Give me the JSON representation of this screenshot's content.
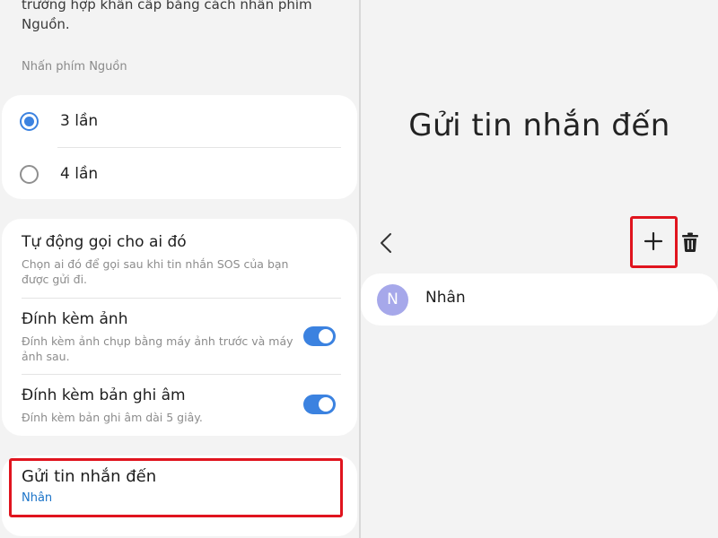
{
  "settings": {
    "intro_text": "trường hợp khẩn cấp bằng cách nhấn phím Nguồn.",
    "section_label": "Nhấn phím Nguồn",
    "press_options": [
      {
        "label": "3 lần",
        "selected": true
      },
      {
        "label": "4 lần",
        "selected": false
      }
    ],
    "auto_call": {
      "title": "Tự động gọi cho ai đó",
      "subtitle": "Chọn ai đó để gọi sau khi tin nhắn SOS của bạn được gửi đi."
    },
    "attach_photo": {
      "title": "Đính kèm ảnh",
      "subtitle": "Đính kèm ảnh chụp bằng máy ảnh trước và máy ảnh sau.",
      "enabled": true
    },
    "attach_audio": {
      "title": "Đính kèm bản ghi âm",
      "subtitle": "Đính kèm bản ghi âm dài 5 giây.",
      "enabled": true
    },
    "send_to": {
      "title": "Gửi tin nhắn đến",
      "value": "Nhân"
    }
  },
  "recipients": {
    "title": "Gửi tin nhắn đến",
    "contacts": [
      {
        "initial": "N",
        "name": "Nhân"
      }
    ]
  },
  "colors": {
    "accent": "#3b82e0",
    "highlight_box": "#e0141e",
    "avatar": "#a6a8ea",
    "link": "#1a73c8"
  },
  "icons": {
    "back": "chevron-left-icon",
    "add": "plus-icon",
    "delete": "trash-icon"
  }
}
